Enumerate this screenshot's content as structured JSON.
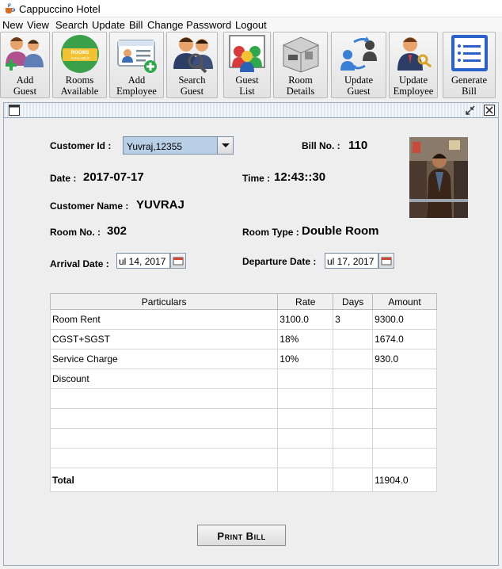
{
  "window": {
    "title": "Cappuccino Hotel",
    "icon": "java-cup-icon"
  },
  "menu": [
    "New",
    "View",
    "Search",
    "Update",
    "Bill",
    "Change Password",
    "Logout"
  ],
  "toolbar": [
    {
      "label1": "Add",
      "label2": "Guest",
      "icon": "add-guest-icon"
    },
    {
      "label1": "Rooms",
      "label2": "Available",
      "icon": "rooms-available-icon"
    },
    {
      "label1": "Add",
      "label2": "Employee",
      "icon": "add-employee-icon"
    },
    {
      "label1": "Search",
      "label2": "Guest",
      "icon": "search-guest-icon"
    },
    {
      "label1": "Guest",
      "label2": "List",
      "icon": "guest-list-icon"
    },
    {
      "label1": "Room",
      "label2": "Details",
      "icon": "room-details-icon"
    },
    {
      "label1": "Update",
      "label2": "Guest",
      "icon": "update-guest-icon"
    },
    {
      "label1": "Update",
      "label2": "Employee",
      "icon": "update-employee-icon"
    },
    {
      "label1": "Generate",
      "label2": "Bill",
      "icon": "generate-bill-icon"
    }
  ],
  "rooms_badge": "ROOMS AVAILABLE",
  "form": {
    "customer_id_label": "Customer Id :",
    "customer_id_value": "Yuvraj,12355",
    "bill_no_label": "Bill No. :",
    "bill_no_value": "110",
    "date_label": "Date :",
    "date_value": "2017-07-17",
    "time_label": "Time :",
    "time_value": "12:43::30",
    "customer_name_label": "Customer Name :",
    "customer_name_value": "YUVRAJ",
    "room_no_label": "Room No. :",
    "room_no_value": "302",
    "room_type_label": "Room Type :",
    "room_type_value": "Double Room",
    "arrival_label": "Arrival Date :",
    "arrival_value": "ul 14, 2017",
    "departure_label": "Departure Date :",
    "departure_value": "ul 17, 2017"
  },
  "table": {
    "headers": [
      "Particulars",
      "Rate",
      "Days",
      "Amount"
    ],
    "rows": [
      [
        "Room Rent",
        "3100.0",
        "3",
        "9300.0"
      ],
      [
        "CGST+SGST",
        "18%",
        "",
        "1674.0"
      ],
      [
        "Service Charge",
        "10%",
        "",
        "930.0"
      ],
      [
        "Discount",
        "",
        "",
        ""
      ],
      [
        "",
        "",
        "",
        ""
      ],
      [
        "",
        "",
        "",
        ""
      ],
      [
        "",
        "",
        "",
        ""
      ],
      [
        "",
        "",
        "",
        ""
      ],
      [
        "Total",
        "",
        "",
        "11904.0"
      ]
    ]
  },
  "print_label": "Print Bill"
}
